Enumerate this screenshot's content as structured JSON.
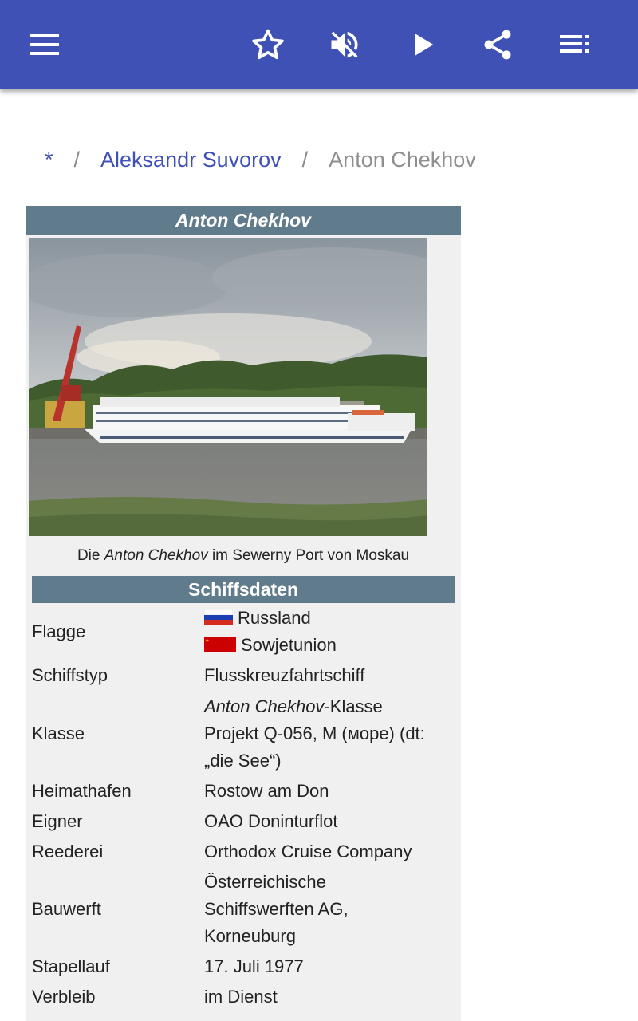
{
  "toolbar": {
    "bg_color": "#3f51b5",
    "icons": [
      "menu-icon",
      "star-outline-icon",
      "volume-off-icon",
      "play-icon",
      "share-icon",
      "playlist-icon"
    ]
  },
  "breadcrumb": {
    "home": "*",
    "separator": "/",
    "parent": "Aleksandr Suvorov",
    "current": "Anton Chekhov"
  },
  "infobox": {
    "title": "Anton Chekhov",
    "caption": {
      "prefix": "Die ",
      "italic": "Anton Chekhov",
      "suffix": " im Sewerny Port von Moskau"
    },
    "section_title": "Schiffsdaten",
    "header_color": "#607b8c",
    "rows": {
      "flagge": {
        "label": "Flagge",
        "values": [
          "Russland",
          "Sowjetunion"
        ]
      },
      "schiffstyp": {
        "label": "Schiffstyp",
        "value": "Flusskreuzfahrtschiff"
      },
      "klasse": {
        "label": "Klasse",
        "line1_italic": "Anton Chekhov",
        "line1_suffix": "-Klasse",
        "line2": "Projekt Q-056, M (море) (dt:",
        "line3": "„die See“)"
      },
      "heimathafen": {
        "label": "Heimathafen",
        "value": "Rostow am Don"
      },
      "eigner": {
        "label": "Eigner",
        "value": "OAO Doninturflot"
      },
      "reederei": {
        "label": "Reederei",
        "value": "Orthodox Cruise Company"
      },
      "bauwerft": {
        "label": "Bauwerft",
        "lines": [
          "Österreichische",
          "Schiffswerften AG,",
          "Korneuburg"
        ]
      },
      "stapellauf": {
        "label": "Stapellauf",
        "value": "17. Juli 1977"
      },
      "verbleib": {
        "label": "Verbleib",
        "value": "im Dienst"
      }
    }
  }
}
